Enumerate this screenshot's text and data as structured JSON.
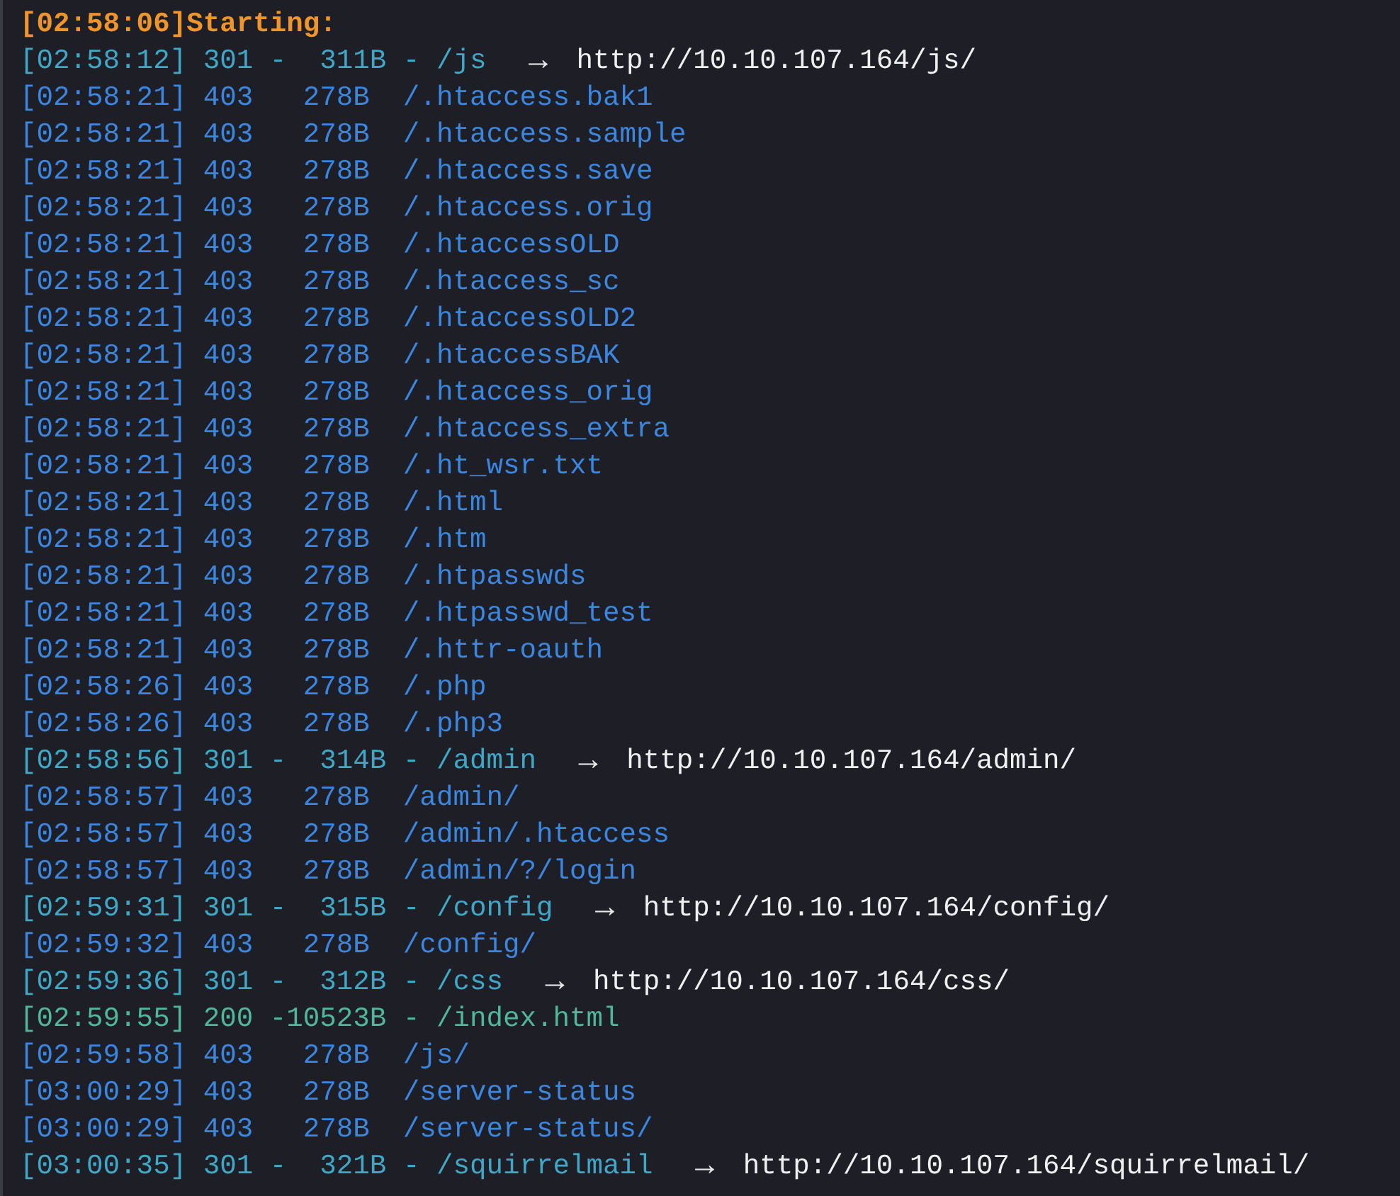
{
  "header": {
    "time": "[02:58:06]",
    "label": "Starting:"
  },
  "lines": [
    {
      "kind": "redirect",
      "time": "[02:58:12]",
      "status": "301",
      "sep1": "-",
      "sep2": "-",
      "size": "311B",
      "path": "/js",
      "arrow": "→",
      "target": "http://10.10.107.164/js/"
    },
    {
      "kind": "forbidden",
      "time": "[02:58:21]",
      "status": "403",
      "size": "278B",
      "path": "/.htaccess.bak1"
    },
    {
      "kind": "forbidden",
      "time": "[02:58:21]",
      "status": "403",
      "size": "278B",
      "path": "/.htaccess.sample"
    },
    {
      "kind": "forbidden",
      "time": "[02:58:21]",
      "status": "403",
      "size": "278B",
      "path": "/.htaccess.save"
    },
    {
      "kind": "forbidden",
      "time": "[02:58:21]",
      "status": "403",
      "size": "278B",
      "path": "/.htaccess.orig"
    },
    {
      "kind": "forbidden",
      "time": "[02:58:21]",
      "status": "403",
      "size": "278B",
      "path": "/.htaccessOLD"
    },
    {
      "kind": "forbidden",
      "time": "[02:58:21]",
      "status": "403",
      "size": "278B",
      "path": "/.htaccess_sc"
    },
    {
      "kind": "forbidden",
      "time": "[02:58:21]",
      "status": "403",
      "size": "278B",
      "path": "/.htaccessOLD2"
    },
    {
      "kind": "forbidden",
      "time": "[02:58:21]",
      "status": "403",
      "size": "278B",
      "path": "/.htaccessBAK"
    },
    {
      "kind": "forbidden",
      "time": "[02:58:21]",
      "status": "403",
      "size": "278B",
      "path": "/.htaccess_orig"
    },
    {
      "kind": "forbidden",
      "time": "[02:58:21]",
      "status": "403",
      "size": "278B",
      "path": "/.htaccess_extra"
    },
    {
      "kind": "forbidden",
      "time": "[02:58:21]",
      "status": "403",
      "size": "278B",
      "path": "/.ht_wsr.txt"
    },
    {
      "kind": "forbidden",
      "time": "[02:58:21]",
      "status": "403",
      "size": "278B",
      "path": "/.html"
    },
    {
      "kind": "forbidden",
      "time": "[02:58:21]",
      "status": "403",
      "size": "278B",
      "path": "/.htm"
    },
    {
      "kind": "forbidden",
      "time": "[02:58:21]",
      "status": "403",
      "size": "278B",
      "path": "/.htpasswds"
    },
    {
      "kind": "forbidden",
      "time": "[02:58:21]",
      "status": "403",
      "size": "278B",
      "path": "/.htpasswd_test"
    },
    {
      "kind": "forbidden",
      "time": "[02:58:21]",
      "status": "403",
      "size": "278B",
      "path": "/.httr-oauth"
    },
    {
      "kind": "forbidden",
      "time": "[02:58:26]",
      "status": "403",
      "size": "278B",
      "path": "/.php"
    },
    {
      "kind": "forbidden",
      "time": "[02:58:26]",
      "status": "403",
      "size": "278B",
      "path": "/.php3"
    },
    {
      "kind": "redirect",
      "time": "[02:58:56]",
      "status": "301",
      "sep1": "-",
      "sep2": "-",
      "size": "314B",
      "path": "/admin",
      "arrow": "→",
      "target": "http://10.10.107.164/admin/"
    },
    {
      "kind": "forbidden",
      "time": "[02:58:57]",
      "status": "403",
      "size": "278B",
      "path": "/admin/"
    },
    {
      "kind": "forbidden",
      "time": "[02:58:57]",
      "status": "403",
      "size": "278B",
      "path": "/admin/.htaccess"
    },
    {
      "kind": "forbidden",
      "time": "[02:58:57]",
      "status": "403",
      "size": "278B",
      "path": "/admin/?/login"
    },
    {
      "kind": "redirect",
      "time": "[02:59:31]",
      "status": "301",
      "sep1": "-",
      "sep2": "-",
      "size": "315B",
      "path": "/config",
      "arrow": "→",
      "target": "http://10.10.107.164/config/"
    },
    {
      "kind": "forbidden",
      "time": "[02:59:32]",
      "status": "403",
      "size": "278B",
      "path": "/config/"
    },
    {
      "kind": "redirect",
      "time": "[02:59:36]",
      "status": "301",
      "sep1": "-",
      "sep2": "-",
      "size": "312B",
      "path": "/css",
      "arrow": "→",
      "target": "http://10.10.107.164/css/"
    },
    {
      "kind": "ok",
      "time": "[02:59:55]",
      "status": "200",
      "sep1": "-",
      "sep2": "-",
      "size": "10523B",
      "path": "/index.html"
    },
    {
      "kind": "forbidden",
      "time": "[02:59:58]",
      "status": "403",
      "size": "278B",
      "path": "/js/"
    },
    {
      "kind": "forbidden",
      "time": "[03:00:29]",
      "status": "403",
      "size": "278B",
      "path": "/server-status"
    },
    {
      "kind": "forbidden",
      "time": "[03:00:29]",
      "status": "403",
      "size": "278B",
      "path": "/server-status/"
    },
    {
      "kind": "redirect",
      "time": "[03:00:35]",
      "status": "301",
      "sep1": "-",
      "sep2": "-",
      "size": "321B",
      "path": "/squirrelmail",
      "arrow": "→",
      "target": "http://10.10.107.164/squirrelmail/"
    }
  ]
}
